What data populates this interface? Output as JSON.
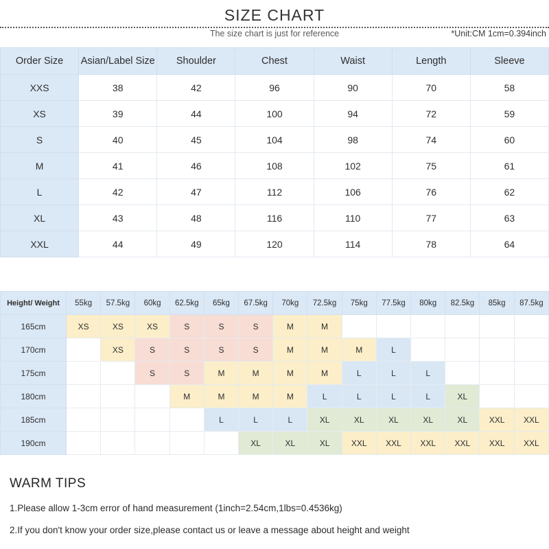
{
  "header": {
    "title": "SIZE CHART",
    "subtitle": "The size chart is just for reference",
    "unit_note": "*Unit:CM 1cm=0.394inch"
  },
  "size_table": {
    "columns": [
      "Order Size",
      "Asian/Label Size",
      "Shoulder",
      "Chest",
      "Waist",
      "Length",
      "Sleeve"
    ],
    "rows": [
      [
        "XXS",
        "38",
        "42",
        "96",
        "90",
        "70",
        "58"
      ],
      [
        "XS",
        "39",
        "44",
        "100",
        "94",
        "72",
        "59"
      ],
      [
        "S",
        "40",
        "45",
        "104",
        "98",
        "74",
        "60"
      ],
      [
        "M",
        "41",
        "46",
        "108",
        "102",
        "75",
        "61"
      ],
      [
        "L",
        "42",
        "47",
        "112",
        "106",
        "76",
        "62"
      ],
      [
        "XL",
        "43",
        "48",
        "116",
        "110",
        "77",
        "63"
      ],
      [
        "XXL",
        "44",
        "49",
        "120",
        "114",
        "78",
        "64"
      ]
    ]
  },
  "height_weight_table": {
    "corner_label": "Height/ Weight",
    "weights": [
      "55kg",
      "57.5kg",
      "60kg",
      "62.5kg",
      "65kg",
      "67.5kg",
      "70kg",
      "72.5kg",
      "75kg",
      "77.5kg",
      "80kg",
      "82.5kg",
      "85kg",
      "87.5kg"
    ],
    "heights": [
      "165cm",
      "170cm",
      "175cm",
      "180cm",
      "185cm",
      "190cm"
    ],
    "cells": [
      [
        "XS",
        "XS",
        "XS",
        "S",
        "S",
        "S",
        "M",
        "M",
        "",
        "",
        "",
        "",
        "",
        ""
      ],
      [
        "",
        "XS",
        "S",
        "S",
        "S",
        "S",
        "M",
        "M",
        "M",
        "L",
        "",
        "",
        "",
        ""
      ],
      [
        "",
        "",
        "S",
        "S",
        "M",
        "M",
        "M",
        "M",
        "L",
        "L",
        "L",
        "",
        "",
        ""
      ],
      [
        "",
        "",
        "",
        "M",
        "M",
        "M",
        "M",
        "L",
        "L",
        "L",
        "L",
        "XL",
        "",
        ""
      ],
      [
        "",
        "",
        "",
        "",
        "L",
        "L",
        "L",
        "XL",
        "XL",
        "XL",
        "XL",
        "XL",
        "XXL",
        "XXL"
      ],
      [
        "",
        "",
        "",
        "",
        "",
        "XL",
        "XL",
        "XL",
        "XXL",
        "XXL",
        "XXL",
        "XXL",
        "XXL",
        "XXL"
      ]
    ],
    "legend_colors": {
      "XS": "#fbeec9",
      "S": "#f7ddd4",
      "M": "#fbeec9",
      "L": "#d9e7f5",
      "XL": "#e0ead4",
      "XXL": "#fbeec9",
      "empty": "#ffffff",
      "header": "#dbe8f6"
    }
  },
  "warm_tips": {
    "title": "WARM TIPS",
    "lines": [
      "1.Please allow 1-3cm error of hand measurement (1inch=2.54cm,1lbs=0.4536kg)",
      "2.If you don't know your order size,please contact us or leave a message about height and weight"
    ]
  }
}
